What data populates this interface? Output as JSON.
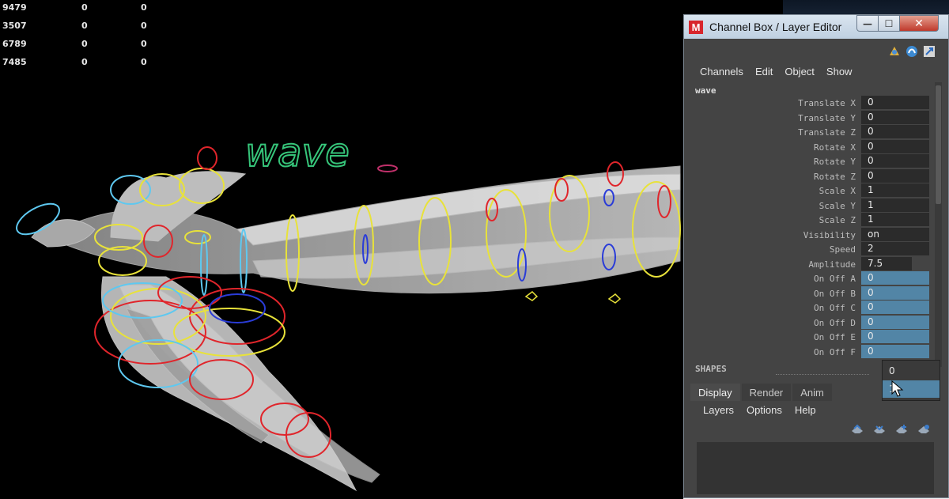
{
  "hud": {
    "rows": [
      [
        "9479",
        "0",
        "0"
      ],
      [
        "3507",
        "0",
        "0"
      ],
      [
        "6789",
        "0",
        "0"
      ],
      [
        "7485",
        "0",
        "0"
      ]
    ]
  },
  "viewport": {
    "label_text": "wave"
  },
  "window": {
    "logo": "M",
    "title": "Channel Box / Layer Editor",
    "min_glyph": "—",
    "max_glyph": "☐",
    "close_glyph": "✕"
  },
  "toolbar_icons": [
    "channel-box-icon",
    "attribute-editor-icon",
    "tool-settings-icon"
  ],
  "menu": [
    "Channels",
    "Edit",
    "Object",
    "Show"
  ],
  "object_name": "wave",
  "attributes": [
    {
      "label": "Translate X",
      "value": "0",
      "style": "dark"
    },
    {
      "label": "Translate Y",
      "value": "0",
      "style": "dark"
    },
    {
      "label": "Translate Z",
      "value": "0",
      "style": "dark"
    },
    {
      "label": "Rotate X",
      "value": "0",
      "style": "dark"
    },
    {
      "label": "Rotate Y",
      "value": "0",
      "style": "dark"
    },
    {
      "label": "Rotate Z",
      "value": "0",
      "style": "dark"
    },
    {
      "label": "Scale X",
      "value": "1",
      "style": "dark"
    },
    {
      "label": "Scale Y",
      "value": "1",
      "style": "dark"
    },
    {
      "label": "Scale Z",
      "value": "1",
      "style": "dark"
    },
    {
      "label": "Visibility",
      "value": "on",
      "style": "dark"
    },
    {
      "label": "Speed",
      "value": "2",
      "style": "dark"
    },
    {
      "label": "Amplitude",
      "value": "7.5",
      "style": "mid"
    },
    {
      "label": "On Off A",
      "value": "0",
      "style": "blue"
    },
    {
      "label": "On Off B",
      "value": "0",
      "style": "blue"
    },
    {
      "label": "On Off C",
      "value": "0",
      "style": "blue"
    },
    {
      "label": "On Off D",
      "value": "0",
      "style": "blue"
    },
    {
      "label": "On Off E",
      "value": "0",
      "style": "blue"
    },
    {
      "label": "On Off F",
      "value": "0",
      "style": "blue"
    }
  ],
  "shapes_label": "SHAPES",
  "dropdown": {
    "options": [
      "0",
      "1"
    ],
    "highlighted": "1"
  },
  "tabs": [
    "Display",
    "Render",
    "Anim"
  ],
  "active_tab": "Display",
  "layer_menu": [
    "Layers",
    "Options",
    "Help"
  ],
  "colors": {
    "panel_bg": "#444444",
    "selected_blue": "#5285a6",
    "curve_red": "#e0252b",
    "curve_yellow": "#e8e23a",
    "curve_cyan": "#5ec8f0",
    "curve_blue": "#2a3cd8",
    "label_green": "#36c57a"
  }
}
